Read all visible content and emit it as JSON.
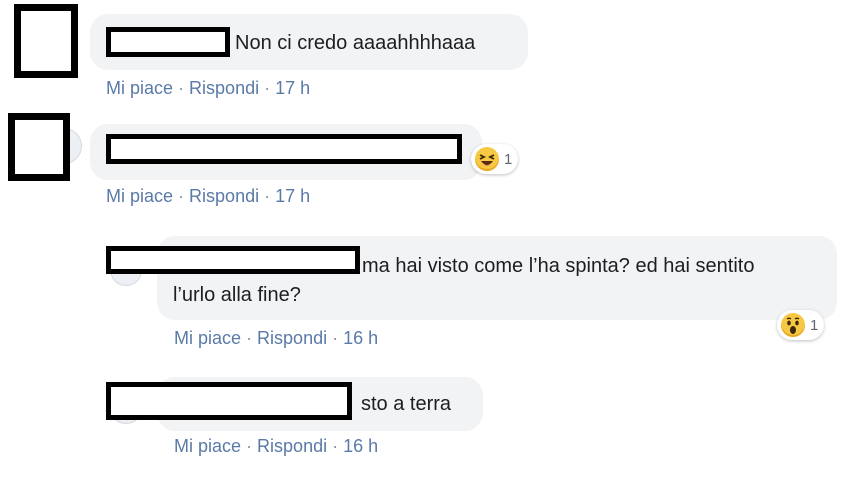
{
  "comments": [
    {
      "text": "Non ci credo aaaahhhhaaa",
      "actions": {
        "like": "Mi piace",
        "reply": "Rispondi",
        "time": "17 h"
      }
    },
    {
      "text": "",
      "reaction": {
        "icon": "laugh-emoji-icon",
        "count": "1"
      },
      "actions": {
        "like": "Mi piace",
        "reply": "Rispondi",
        "time": "17 h"
      }
    }
  ],
  "replies": [
    {
      "text_line1": "ma hai visto come l’ha spinta? ed hai sentito",
      "text_line2": "l’urlo alla fine?",
      "reaction": {
        "icon": "wow-emoji-icon",
        "count": "1"
      },
      "actions": {
        "like": "Mi piace",
        "reply": "Rispondi",
        "time": "16 h"
      }
    },
    {
      "text": "sto a terra",
      "actions": {
        "like": "Mi piace",
        "reply": "Rispondi",
        "time": "16 h"
      }
    }
  ],
  "separator": "·",
  "colors": {
    "bubble": "#f2f3f5",
    "link": "#5a7aa7",
    "text": "#1c1e21",
    "emoji": "#f7c844"
  }
}
